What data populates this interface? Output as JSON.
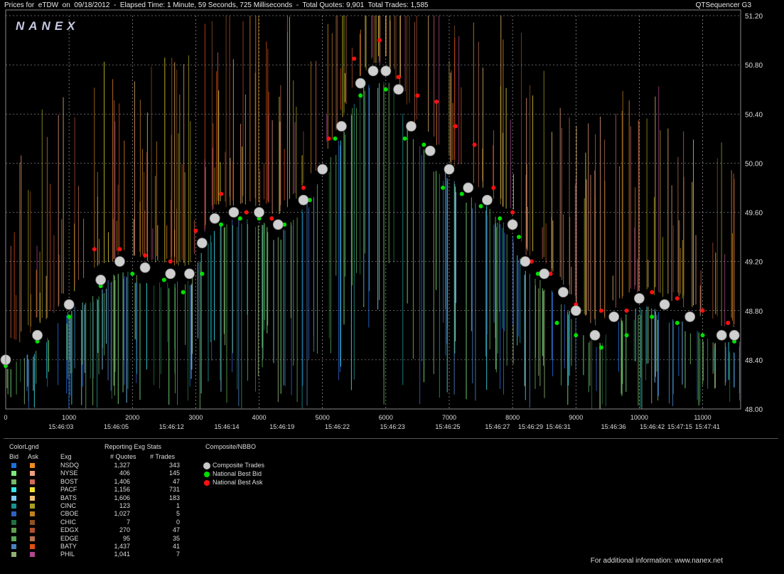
{
  "header": {
    "title": "Prices for  eTDW  on  09/18/2012  -  Elapsed Time: 1 Minute, 59 Seconds, 725 Milliseconds  -  Total Quotes: 9,901  Total Trades: 1,585",
    "app": "QTSequencer G3"
  },
  "watermark": "NANEX",
  "chart_data": {
    "type": "line",
    "x_ticks": [
      "0",
      "1000",
      "2000",
      "3000",
      "4000",
      "5000",
      "6000",
      "7000",
      "8000",
      "9000",
      "10000",
      "11000"
    ],
    "x_tick_values": [
      0,
      1000,
      2000,
      3000,
      4000,
      5000,
      6000,
      7000,
      8000,
      9000,
      10000,
      11000
    ],
    "time_labels": [
      "15:46:03",
      "15:46:05",
      "15:46:12",
      "15:46:14",
      "15:46:19",
      "15:46:22",
      "15:46:23",
      "15:46:25",
      "15:46:27",
      "15:46:29",
      "15:46:31",
      "15:46:36",
      "15:46:42",
      "15:47:15",
      "15:47:41"
    ],
    "time_label_x": [
      1000,
      2000,
      3000,
      4000,
      5000,
      6000,
      7000,
      8000,
      8900,
      9500,
      10000,
      11000,
      11700,
      12200,
      12700
    ],
    "y_ticks": [
      "51.20",
      "50.80",
      "50.40",
      "50.00",
      "49.60",
      "49.20",
      "48.80",
      "48.40",
      "48.00"
    ],
    "y_tick_values": [
      51.2,
      50.8,
      50.4,
      50.0,
      49.6,
      49.2,
      48.8,
      48.4,
      48.0
    ],
    "ylim": [
      48.0,
      51.2
    ],
    "xlim": [
      0,
      11600
    ],
    "grid": true,
    "series": [
      {
        "name": "Composite Trades",
        "x": [
          0,
          500,
          1000,
          1500,
          1800,
          2200,
          2600,
          2900,
          3100,
          3300,
          3600,
          4000,
          4300,
          4700,
          5000,
          5300,
          5600,
          5800,
          6000,
          6200,
          6400,
          6700,
          7000,
          7300,
          7600,
          8000,
          8200,
          8500,
          8800,
          9000,
          9300,
          9600,
          10000,
          10400,
          10800,
          11300,
          11500
        ],
        "y": [
          48.4,
          48.6,
          48.85,
          49.05,
          49.2,
          49.15,
          49.1,
          49.1,
          49.35,
          49.55,
          49.6,
          49.6,
          49.5,
          49.7,
          49.95,
          50.3,
          50.65,
          50.75,
          50.75,
          50.6,
          50.3,
          50.1,
          49.95,
          49.8,
          49.7,
          49.5,
          49.2,
          49.1,
          48.95,
          48.8,
          48.6,
          48.75,
          48.9,
          48.85,
          48.75,
          48.6,
          48.6
        ]
      },
      {
        "name": "National Best Bid",
        "x": [
          0,
          500,
          1000,
          1500,
          2000,
          2500,
          2800,
          3100,
          3400,
          3700,
          4000,
          4400,
          4800,
          5200,
          5600,
          6000,
          6300,
          6600,
          6900,
          7200,
          7500,
          7800,
          8100,
          8400,
          8700,
          9000,
          9400,
          9800,
          10200,
          10600,
          11000,
          11500
        ],
        "y": [
          48.35,
          48.55,
          48.75,
          49.0,
          49.1,
          49.05,
          48.95,
          49.1,
          49.5,
          49.55,
          49.55,
          49.5,
          49.7,
          50.2,
          50.55,
          50.6,
          50.2,
          50.15,
          49.8,
          49.75,
          49.65,
          49.55,
          49.4,
          49.1,
          48.7,
          48.6,
          48.5,
          48.6,
          48.75,
          48.7,
          48.6,
          48.55
        ]
      },
      {
        "name": "National Best Ask",
        "x": [
          1400,
          1800,
          2200,
          2600,
          3000,
          3400,
          3800,
          4200,
          4700,
          5100,
          5500,
          5900,
          6200,
          6500,
          6800,
          7100,
          7400,
          7700,
          8000,
          8300,
          8600,
          9000,
          9400,
          9800,
          10200,
          10600,
          11000,
          11400
        ],
        "y": [
          49.3,
          49.3,
          49.25,
          49.2,
          49.45,
          49.75,
          49.6,
          49.55,
          49.8,
          50.2,
          50.85,
          51.0,
          50.7,
          50.55,
          50.5,
          50.3,
          50.15,
          49.8,
          49.6,
          49.2,
          49.1,
          48.85,
          48.8,
          48.8,
          48.95,
          48.9,
          48.8,
          48.7
        ]
      }
    ]
  },
  "legend": {
    "heading": "ColorLgnd",
    "bid": "Bid",
    "ask": "Ask",
    "exch_heading": "Exg",
    "stats_heading": "Reporting Exg Stats",
    "quotes_heading": "# Quotes",
    "trades_heading": "# Trades",
    "composite_heading": "Composite/NBBO",
    "rows": [
      {
        "exch": "NSDQ",
        "quotes": "1,327",
        "trades": "343",
        "bid": "#1e6fd8",
        "ask": "#f08c1e"
      },
      {
        "exch": "NYSE",
        "quotes": "406",
        "trades": "145",
        "bid": "#7ce87c",
        "ask": "#f0a080"
      },
      {
        "exch": "BOST",
        "quotes": "1,406",
        "trades": "47",
        "bid": "#74b868",
        "ask": "#d06a5a"
      },
      {
        "exch": "PACF",
        "quotes": "1,156",
        "trades": "731",
        "bid": "#3ae0e8",
        "ask": "#f0e030"
      },
      {
        "exch": "BATS",
        "quotes": "1,606",
        "trades": "183",
        "bid": "#80c8f8",
        "ask": "#f0c070"
      },
      {
        "exch": "CINC",
        "quotes": "123",
        "trades": "1",
        "bid": "#1a9090",
        "ask": "#a8a020"
      },
      {
        "exch": "CBOE",
        "quotes": "1,027",
        "trades": "5",
        "bid": "#3060c0",
        "ask": "#c08020"
      },
      {
        "exch": "CHIC",
        "quotes": "7",
        "trades": "0",
        "bid": "#207040",
        "ask": "#905020"
      },
      {
        "exch": "EDGX",
        "quotes": "270",
        "trades": "47",
        "bid": "#60a050",
        "ask": "#b05030"
      },
      {
        "exch": "EDGE",
        "quotes": "95",
        "trades": "35",
        "bid": "#5aa858",
        "ask": "#b87050"
      },
      {
        "exch": "BATY",
        "quotes": "1,437",
        "trades": "41",
        "bid": "#4a80c0",
        "ask": "#e05010"
      },
      {
        "exch": "PHIL",
        "quotes": "1,041",
        "trades": "7",
        "bid": "#90b070",
        "ask": "#b04890"
      }
    ],
    "composite": [
      {
        "label": "Composite Trades",
        "color": "#c8c8c8"
      },
      {
        "label": "National Best Bid",
        "color": "#00e000"
      },
      {
        "label": "National Best Ask",
        "color": "#ff1010"
      }
    ]
  },
  "footer": "For additional information: www.nanex.net"
}
